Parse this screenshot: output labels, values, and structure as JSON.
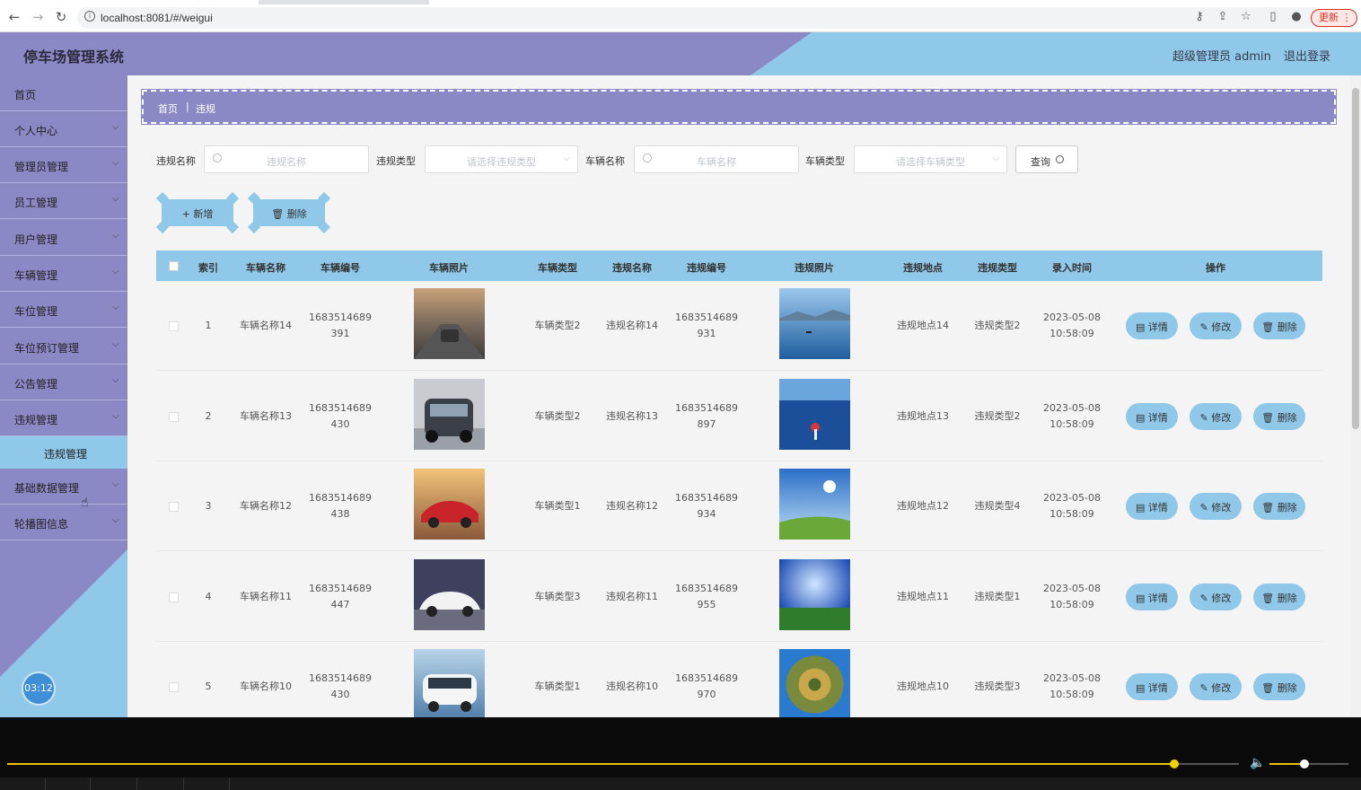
{
  "browser": {
    "url": "localhost:8081/#/weigui",
    "update_label": "更新"
  },
  "header": {
    "title": "停车场管理系统",
    "user": "超级管理员 admin",
    "logout": "退出登录"
  },
  "sidebar": {
    "items": [
      {
        "label": "首页",
        "chevron": false
      },
      {
        "label": "个人中心",
        "chevron": true
      },
      {
        "label": "管理员管理",
        "chevron": true
      },
      {
        "label": "员工管理",
        "chevron": true
      },
      {
        "label": "用户管理",
        "chevron": true
      },
      {
        "label": "车辆管理",
        "chevron": true
      },
      {
        "label": "车位管理",
        "chevron": true
      },
      {
        "label": "车位预订管理",
        "chevron": true
      },
      {
        "label": "公告管理",
        "chevron": true
      },
      {
        "label": "违规管理",
        "chevron": true,
        "expanded": true
      },
      {
        "label": "基础数据管理",
        "chevron": true
      },
      {
        "label": "轮播图信息",
        "chevron": true
      }
    ],
    "submenu_active": "违规管理",
    "timer": "03:12"
  },
  "breadcrumb": {
    "home": "首页",
    "separator": "|",
    "current": "违规"
  },
  "filters": {
    "violation_name_label": "违规名称",
    "violation_name_placeholder": "违规名称",
    "violation_type_label": "违规类型",
    "violation_type_placeholder": "请选择违规类型",
    "vehicle_name_label": "车辆名称",
    "vehicle_name_placeholder": "车辆名称",
    "vehicle_type_label": "车辆类型",
    "vehicle_type_placeholder": "请选择车辆类型",
    "query_label": "查询"
  },
  "actions": {
    "add_label": "+ 新增",
    "delete_label": "🗑 删除"
  },
  "table": {
    "headers": [
      "索引",
      "车辆名称",
      "车辆编号",
      "车辆照片",
      "车辆类型",
      "违规名称",
      "违规编号",
      "违规照片",
      "违规地点",
      "违规类型",
      "录入时间",
      "操作"
    ],
    "op_labels": {
      "detail": "▤ 详情",
      "edit": "✎ 修改",
      "delete": "🗑 删除"
    },
    "rows": [
      {
        "index": "1",
        "vehicle_name": "车辆名称14",
        "vehicle_no_1": "1683514689",
        "vehicle_no_2": "391",
        "vehicle_type": "车辆类型2",
        "violation_name": "违规名称14",
        "violation_no_1": "1683514689",
        "violation_no_2": "931",
        "location": "违规地点14",
        "violation_type": "违规类型2",
        "date": "2023-05-08",
        "time": "10:58:09",
        "car_img": "road",
        "vio_img": "lake"
      },
      {
        "index": "2",
        "vehicle_name": "车辆名称13",
        "vehicle_no_1": "1683514689",
        "vehicle_no_2": "430",
        "vehicle_type": "车辆类型2",
        "violation_name": "违规名称13",
        "violation_no_1": "1683514689",
        "violation_no_2": "897",
        "location": "违规地点13",
        "violation_type": "违规类型2",
        "date": "2023-05-08",
        "time": "10:58:09",
        "car_img": "showroom",
        "vio_img": "sea"
      },
      {
        "index": "3",
        "vehicle_name": "车辆名称12",
        "vehicle_no_1": "1683514689",
        "vehicle_no_2": "438",
        "vehicle_type": "车辆类型1",
        "violation_name": "违规名称12",
        "violation_no_1": "1683514689",
        "violation_no_2": "934",
        "location": "违规地点12",
        "violation_type": "违规类型4",
        "date": "2023-05-08",
        "time": "10:58:09",
        "car_img": "sunset",
        "vio_img": "field"
      },
      {
        "index": "4",
        "vehicle_name": "车辆名称11",
        "vehicle_no_1": "1683514689",
        "vehicle_no_2": "447",
        "vehicle_type": "车辆类型3",
        "violation_name": "违规名称11",
        "violation_no_1": "1683514689",
        "violation_no_2": "955",
        "location": "违规地点11",
        "violation_type": "违规类型1",
        "date": "2023-05-08",
        "time": "10:58:09",
        "car_img": "white",
        "vio_img": "grass"
      },
      {
        "index": "5",
        "vehicle_name": "车辆名称10",
        "vehicle_no_1": "1683514689",
        "vehicle_no_2": "430",
        "vehicle_type": "车辆类型1",
        "violation_name": "违规名称10",
        "violation_no_1": "1683514689",
        "violation_no_2": "970",
        "location": "违规地点10",
        "violation_type": "违规类型3",
        "date": "2023-05-08",
        "time": "10:58:09",
        "car_img": "van",
        "vio_img": "planet"
      }
    ]
  }
}
